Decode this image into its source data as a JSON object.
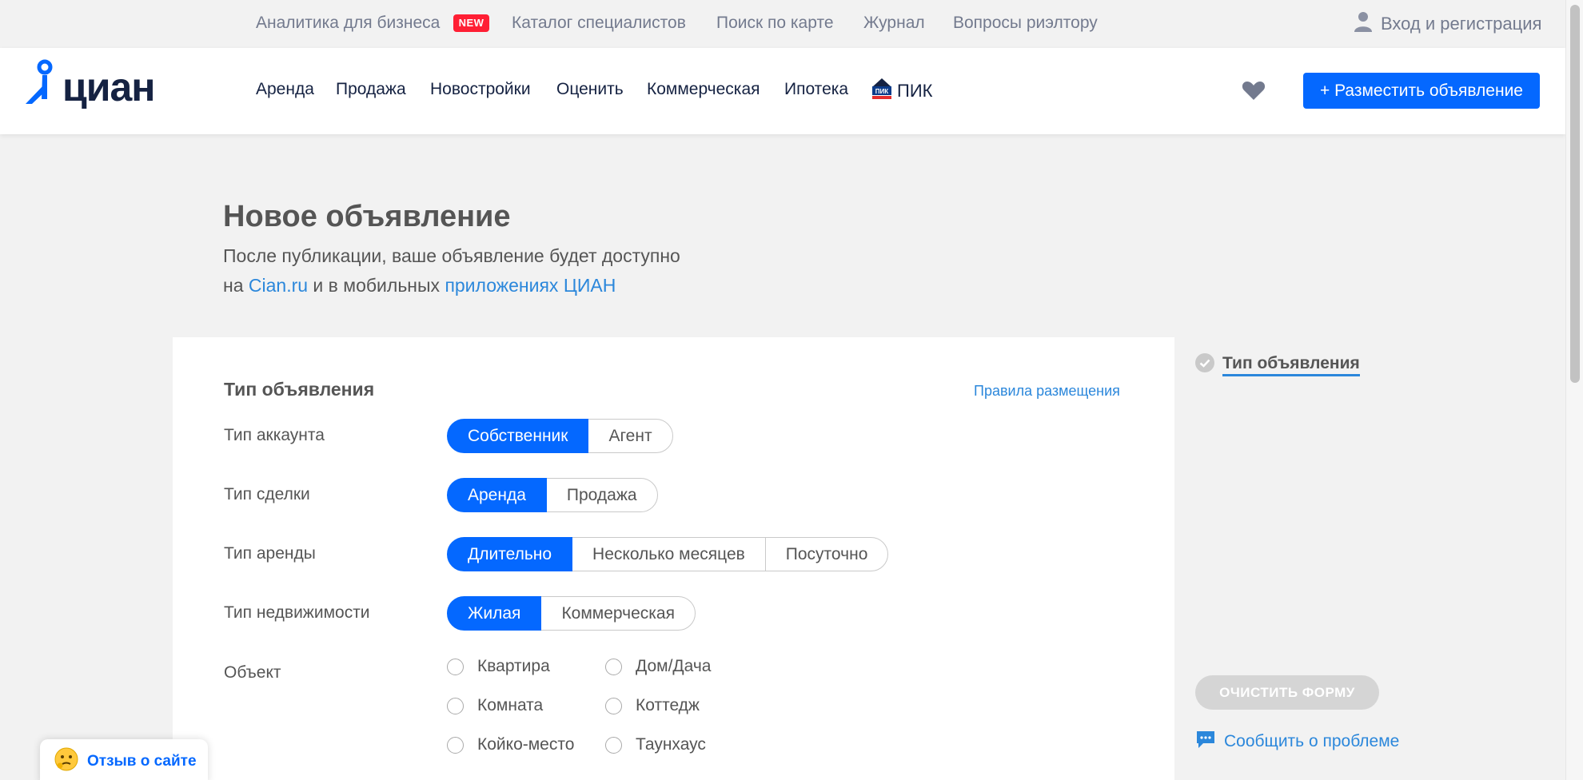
{
  "topbar": {
    "links": [
      "Аналитика для бизнеса",
      "Каталог специалистов",
      "Поиск по карте",
      "Журнал",
      "Вопросы риэлтору"
    ],
    "new_badge": "NEW",
    "login": "Вход и регистрация"
  },
  "header": {
    "logo": "циан",
    "nav": [
      "Аренда",
      "Продажа",
      "Новостройки",
      "Оценить",
      "Коммерческая",
      "Ипотека"
    ],
    "pik": "ПИК",
    "pik_logo_text": "ПИК",
    "post_button": "+ Разместить объявление"
  },
  "page": {
    "title": "Новое объявление",
    "subtitle_part1": "После публикации, ваше объявление будет доступно",
    "subtitle_part2": "на ",
    "subtitle_link1": "Cian.ru",
    "subtitle_part3": " и в мобильных ",
    "subtitle_link2": "приложениях ЦИАН"
  },
  "form": {
    "section_title": "Тип объявления",
    "rules_link": "Правила размещения",
    "account_type": {
      "label": "Тип аккаунта",
      "options": [
        "Собственник",
        "Агент"
      ],
      "selected": 0
    },
    "deal_type": {
      "label": "Тип сделки",
      "options": [
        "Аренда",
        "Продажа"
      ],
      "selected": 0
    },
    "rent_type": {
      "label": "Тип аренды",
      "options": [
        "Длительно",
        "Несколько месяцев",
        "Посуточно"
      ],
      "selected": 0
    },
    "property_type": {
      "label": "Тип недвижимости",
      "options": [
        "Жилая",
        "Коммерческая"
      ],
      "selected": 0
    },
    "object": {
      "label": "Объект",
      "col1": [
        "Квартира",
        "Комната",
        "Койко-место"
      ],
      "col2": [
        "Дом/Дача",
        "Коттедж",
        "Таунхаус"
      ]
    }
  },
  "sidebar": {
    "step": "Тип объявления",
    "clear_button": "ОЧИСТИТЬ ФОРМУ",
    "report": "Сообщить о проблеме"
  },
  "feedback": {
    "label": "Отзыв о сайте"
  },
  "colors": {
    "accent": "#0468ff",
    "link": "#2b87db",
    "badge": "#ff1f34"
  }
}
